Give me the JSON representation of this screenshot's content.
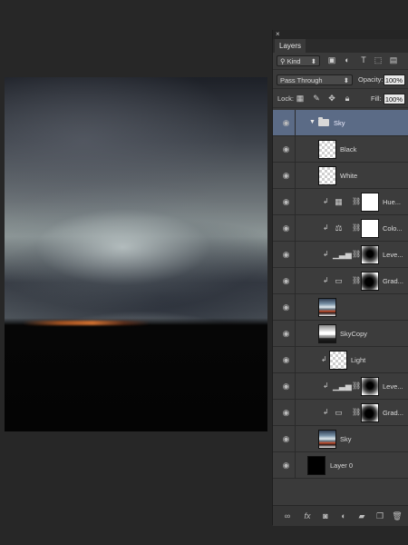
{
  "panel": {
    "close_label": "×",
    "tab_label": "Layers",
    "filter": {
      "kind_label": "Kind",
      "search_icon": "search-icon"
    },
    "blend_mode": "Pass Through",
    "opacity_label": "Opacity:",
    "opacity_value": "100%",
    "lock_label": "Lock:",
    "fill_label": "Fill:",
    "fill_value": "100%"
  },
  "layers": [
    {
      "name": "Sky",
      "kind": "group",
      "selected": true
    },
    {
      "name": "Black",
      "kind": "fill"
    },
    {
      "name": "White",
      "kind": "fill"
    },
    {
      "name": "Hue...",
      "kind": "adjustment",
      "adj_icon": "hue-saturation-icon"
    },
    {
      "name": "Colo...",
      "kind": "adjustment",
      "adj_icon": "color-balance-icon"
    },
    {
      "name": "Leve...",
      "kind": "adjustment",
      "adj_icon": "levels-icon"
    },
    {
      "name": "Grad...",
      "kind": "adjustment",
      "adj_icon": "gradient-map-icon"
    },
    {
      "name": "",
      "kind": "image"
    },
    {
      "name": "SkyCopy",
      "kind": "image"
    },
    {
      "name": "Light",
      "kind": "fill"
    },
    {
      "name": "Leve...",
      "kind": "adjustment",
      "adj_icon": "levels-icon"
    },
    {
      "name": "Grad...",
      "kind": "adjustment",
      "adj_icon": "gradient-map-icon"
    },
    {
      "name": "Sky",
      "kind": "image"
    },
    {
      "name": "Layer 0",
      "kind": "image"
    }
  ]
}
